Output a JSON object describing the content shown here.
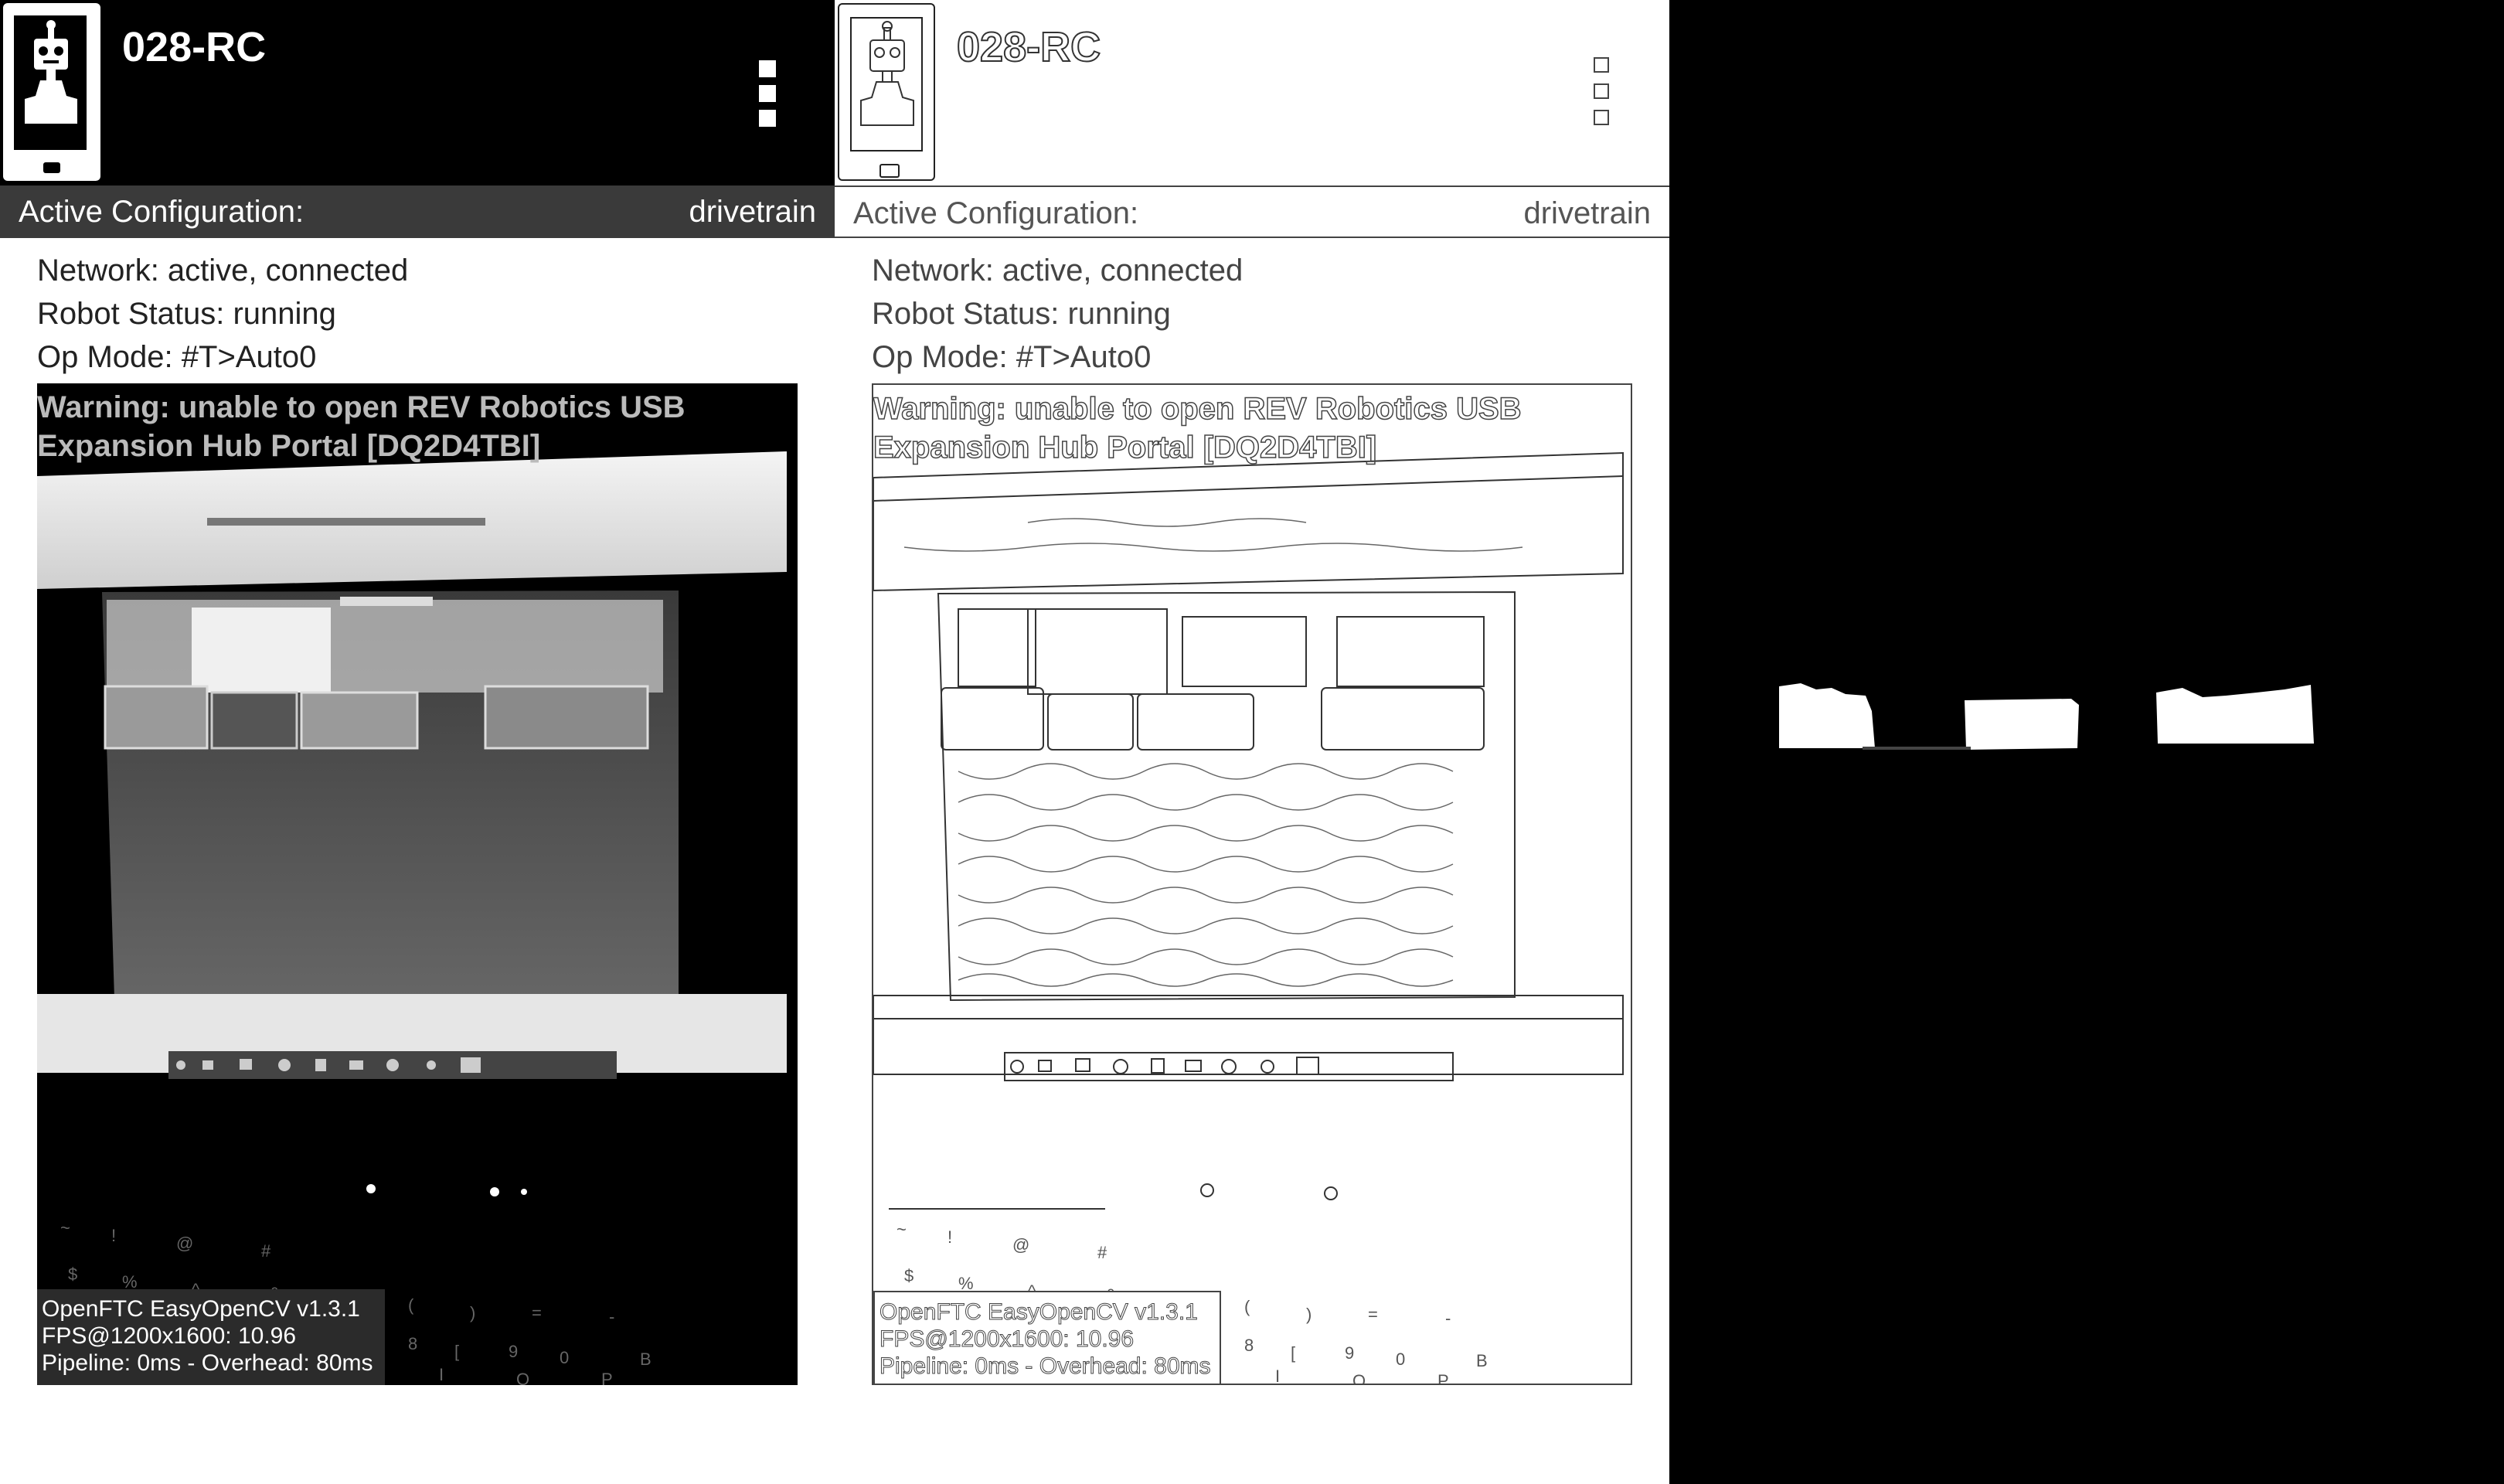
{
  "header": {
    "title": "028-RC",
    "icon": "robot-phone-icon",
    "menu_icon": "overflow-menu-icon"
  },
  "config": {
    "label": "Active Configuration:",
    "value": "drivetrain"
  },
  "status": {
    "network": "Network: active, connected",
    "robot": "Robot Status: running",
    "op_mode": "Op Mode: #T>Auto0"
  },
  "camera": {
    "warning": "Warning: unable to open REV Robotics USB Expansion Hub Portal [DQ2D4TBI]",
    "overlay": {
      "line1": "OpenFTC EasyOpenCV v1.3.1",
      "line2": "FPS@1200x1600: 10.96",
      "line3": "Pipeline: 0ms - Overhead: 80ms"
    }
  },
  "views": {
    "view1": "grayscale-camera-feed",
    "view2": "edge-detection-feed",
    "view3": "threshold-mask"
  },
  "colors": {
    "appbar_dark": "#000000",
    "config_dark": "#3a3a3a",
    "mask_bg": "#000000",
    "mask_blob": "#ffffff"
  }
}
